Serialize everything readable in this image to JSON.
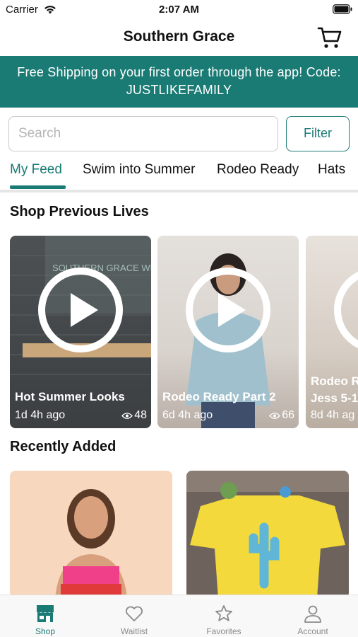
{
  "status_bar": {
    "carrier": "Carrier",
    "time": "2:07 AM"
  },
  "nav": {
    "title": "Southern Grace"
  },
  "banner": {
    "line1": "Free Shipping on your first order through the app! Code:",
    "line2": "JUSTLIKEFAMILY"
  },
  "search": {
    "placeholder": "Search",
    "value": ""
  },
  "filter": {
    "label": "Filter"
  },
  "tabs": [
    {
      "label": "My Feed",
      "active": true
    },
    {
      "label": "Swim into Summer",
      "active": false
    },
    {
      "label": "Rodeo Ready",
      "active": false
    },
    {
      "label": "Hats",
      "active": false
    }
  ],
  "previous_lives": {
    "title": "Shop Previous Lives",
    "items": [
      {
        "title": "Hot Summer Looks",
        "time": "1d 4h ago",
        "views": "48",
        "thumb_text": "SOUTHERN GRACE WHOLESALE"
      },
      {
        "title": "Rodeo Ready Part 2",
        "time": "6d 4h ago",
        "views": "66"
      },
      {
        "title": "Rodeo R",
        "subtitle": "Jess 5-1",
        "time": "8d 4h ag"
      }
    ]
  },
  "recently_added": {
    "title": "Recently Added"
  },
  "tab_bar": [
    {
      "label": "Shop",
      "icon": "store-icon",
      "active": true
    },
    {
      "label": "Waitlist",
      "icon": "heart-icon",
      "active": false
    },
    {
      "label": "Favorites",
      "icon": "star-icon",
      "active": false
    },
    {
      "label": "Account",
      "icon": "person-icon",
      "active": false
    }
  ],
  "colors": {
    "accent": "#1a7a74",
    "banner_bg": "#1a7a74",
    "inactive": "#8a8a8a"
  }
}
